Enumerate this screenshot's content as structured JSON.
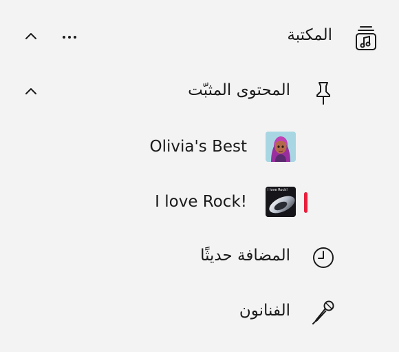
{
  "sidebar": {
    "library": {
      "label": "المكتبة",
      "icon": "library-music-icon",
      "more_icon": "more-dots-icon",
      "chevron_icon": "chevron-up-icon"
    },
    "pinned": {
      "label": "المحتوى المثبّت",
      "icon": "pin-icon",
      "chevron_icon": "chevron-up-icon",
      "items": [
        {
          "label": "Olivia's Best",
          "thumb": "olivia-avatar-thumbnail"
        },
        {
          "label": "I love Rock!",
          "thumb": "rock-playlist-thumbnail",
          "thumb_text": "I love Rock!",
          "active": true
        }
      ]
    },
    "recent": {
      "label": "المضافة حديثًا",
      "icon": "clock-icon"
    },
    "artists": {
      "label": "الفنانون",
      "icon": "microphone-icon"
    }
  },
  "colors": {
    "background": "#f3f3f3",
    "text": "#1a1a1a",
    "accent": "#e81e3c"
  }
}
